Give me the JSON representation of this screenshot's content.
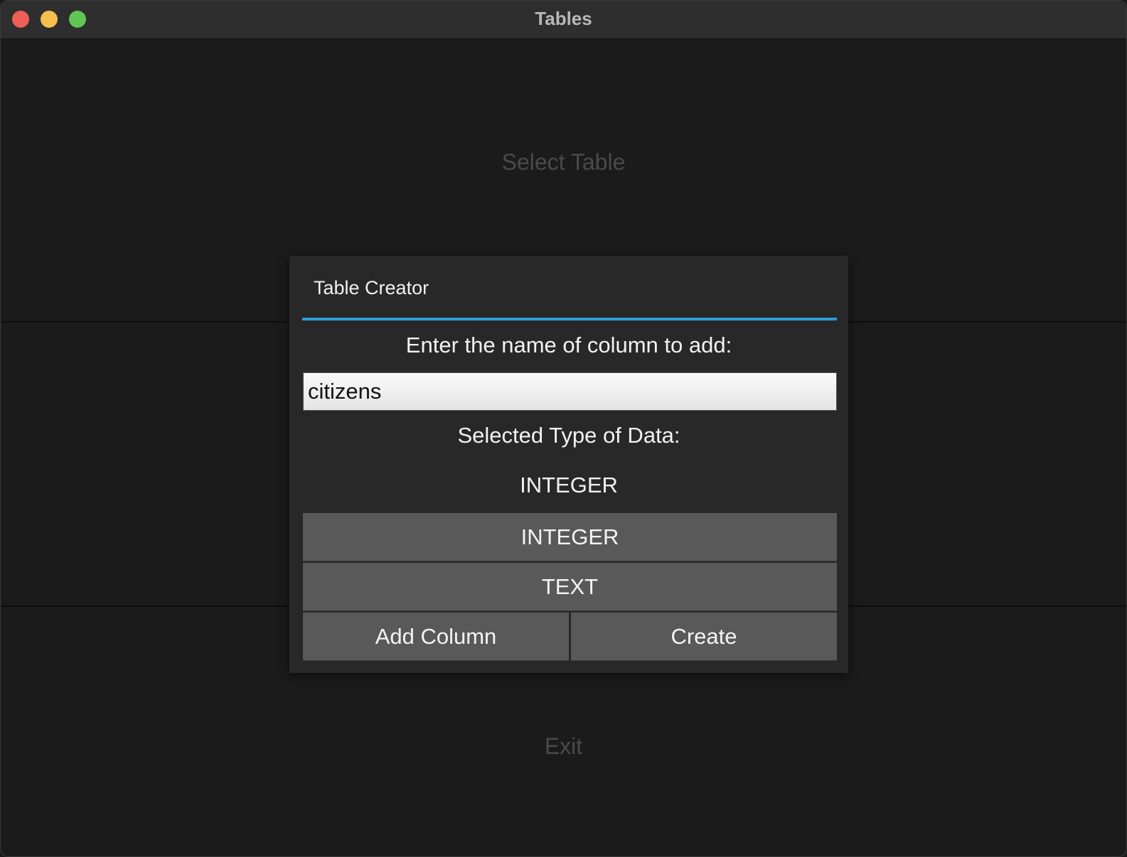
{
  "window": {
    "title": "Tables"
  },
  "main": {
    "select_table_label": "Select Table",
    "exit_label": "Exit"
  },
  "dialog": {
    "title": "Table Creator",
    "prompt": "Enter the name of column to add:",
    "column_name_value": "citizens",
    "selected_type_label": "Selected Type of Data:",
    "selected_type_value": "INTEGER",
    "type_options": [
      "INTEGER",
      "TEXT"
    ],
    "add_column_label": "Add Column",
    "create_label": "Create"
  },
  "colors": {
    "accent": "#2a9fd6",
    "button_bg": "#595959",
    "dialog_bg": "#282828",
    "window_bg": "#1b1b1b"
  }
}
